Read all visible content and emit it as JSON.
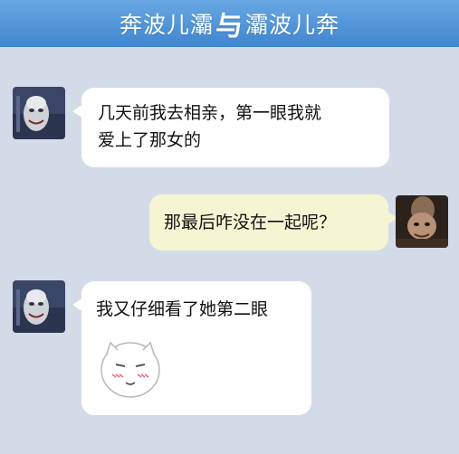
{
  "header": {
    "title_left": "奔波儿灞",
    "title_mid": "与",
    "title_right": "灞波儿奔"
  },
  "messages": [
    {
      "side": "left",
      "text_line1": "几天前我去相亲，第一眼我就",
      "text_line2": "爱上了那女的"
    },
    {
      "side": "right",
      "text": "那最后咋没在一起呢？"
    },
    {
      "side": "left",
      "text": "我又仔细看了她第二眼",
      "sticker": "blushing-face-sticker"
    }
  ],
  "colors": {
    "titlebar": "#4f93d8",
    "background": "#d4dbe8",
    "bubble_left": "#ffffff",
    "bubble_right": "#f6f5d3"
  }
}
